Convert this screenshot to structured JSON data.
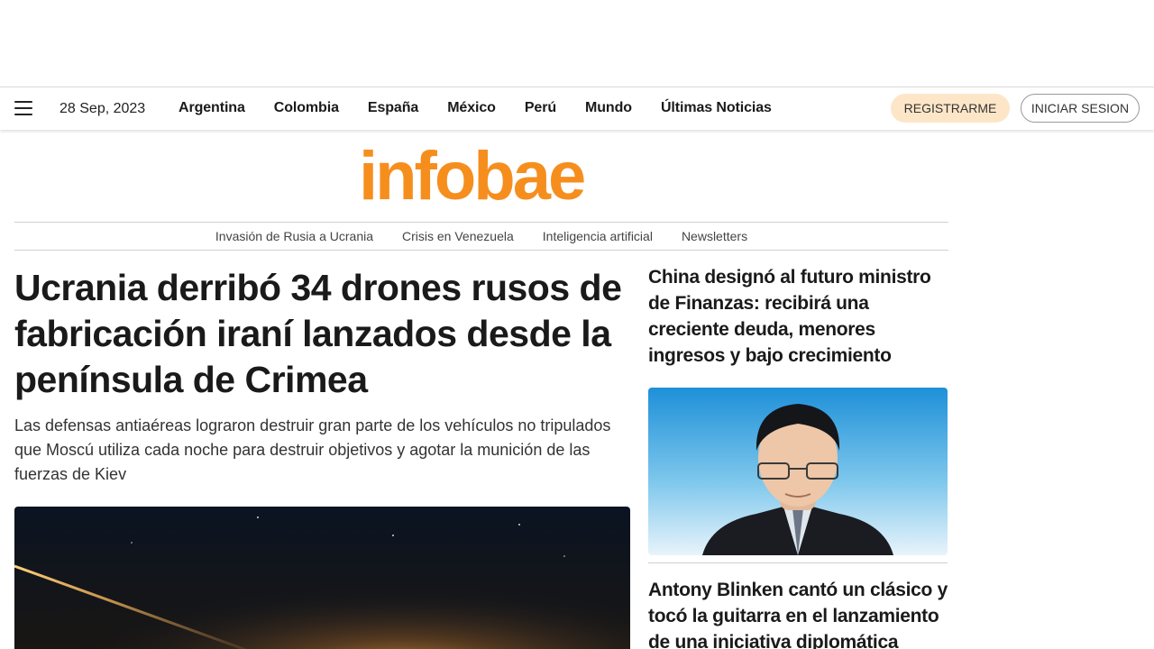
{
  "header": {
    "date": "28 Sep, 2023",
    "nav": [
      "Argentina",
      "Colombia",
      "España",
      "México",
      "Perú",
      "Mundo",
      "Últimas Noticias"
    ],
    "register_label": "REGISTRARME",
    "login_label": "INICIAR SESION"
  },
  "brand": {
    "logo_text": "infobae",
    "logo_color": "#f68e1e",
    "register_bg": "#fde6c8"
  },
  "subnav": [
    "Invasión de Rusia a Ucrania",
    "Crisis en Venezuela",
    "Inteligencia artificial",
    "Newsletters"
  ],
  "main_story": {
    "headline": "Ucrania derribó 34 drones rusos de fabricación iraní lanzados desde la península de Crimea",
    "deck": "Las defensas antiaéreas lograron destruir gran parte de los vehículos no tripulados que Moscú utiliza cada noche para destruir objetivos y agotar la munición de las fuerzas de Kiev",
    "image_icon": "night-sky-tracer-photo"
  },
  "side_stories": [
    {
      "headline": "China designó al futuro ministro de Finanzas: recibirá una creciente deuda, menores ingresos y bajo crecimiento",
      "image_icon": "portrait-photo"
    },
    {
      "headline": "Antony Blinken cantó un clásico y tocó la guitarra en el lanzamiento de una iniciativa diplomática"
    }
  ]
}
